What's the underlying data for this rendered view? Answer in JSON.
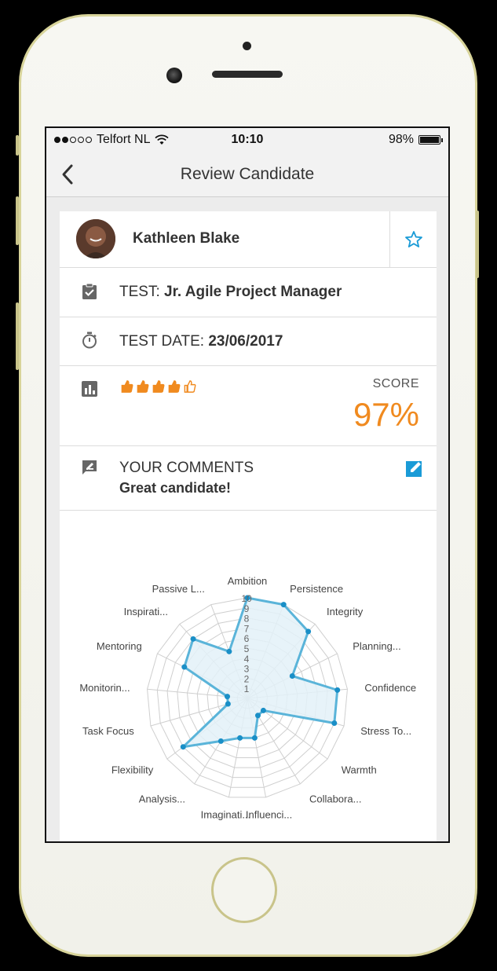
{
  "status_bar": {
    "carrier": "Telfort NL",
    "time": "10:10",
    "battery": "98%",
    "battery_level": 0.98
  },
  "nav": {
    "title": "Review Candidate",
    "back_icon": "chevron-left-icon"
  },
  "candidate": {
    "name": "Kathleen Blake",
    "favorite_icon": "star-outline-icon"
  },
  "test": {
    "label": "TEST:",
    "value": "Jr. Agile Project Manager",
    "icon": "clipboard-check-icon"
  },
  "test_date": {
    "label": "TEST DATE:",
    "value": "23/06/2017",
    "icon": "stopwatch-icon"
  },
  "score": {
    "label": "SCORE",
    "value": "97%",
    "rating": 4.5,
    "rating_max": 5,
    "rating_icon": "thumbs-up-icon",
    "icon": "bar-chart-icon",
    "color": "#f08a1f"
  },
  "comments": {
    "title": "YOUR COMMENTS",
    "text": "Great candidate!",
    "icon": "comment-edit-icon",
    "edit_icon": "edit-icon",
    "accent": "#1a9bd7"
  },
  "chart_data": {
    "type": "radar",
    "categories": [
      "Ambition",
      "Persistence",
      "Integrity",
      "Planning...",
      "Confidence",
      "Stress To...",
      "Warmth",
      "Collabora...",
      "Influenci...",
      "Imaginati...",
      "Analysis...",
      "Flexibility",
      "Task Focus",
      "Monitorin...",
      "Mentoring",
      "Inspirati...",
      "Passive L..."
    ],
    "values": [
      10,
      10,
      9,
      5,
      9,
      9,
      2,
      2,
      4,
      4,
      5,
      8,
      2,
      2,
      7,
      8,
      5
    ],
    "rlim": [
      0,
      10
    ],
    "ticks": [
      "1",
      "2",
      "3",
      "4",
      "5",
      "6",
      "7",
      "8",
      "9",
      "10"
    ],
    "series_color": "#5ab4d9",
    "fill_color": "#e3f1f8",
    "grid": true
  }
}
